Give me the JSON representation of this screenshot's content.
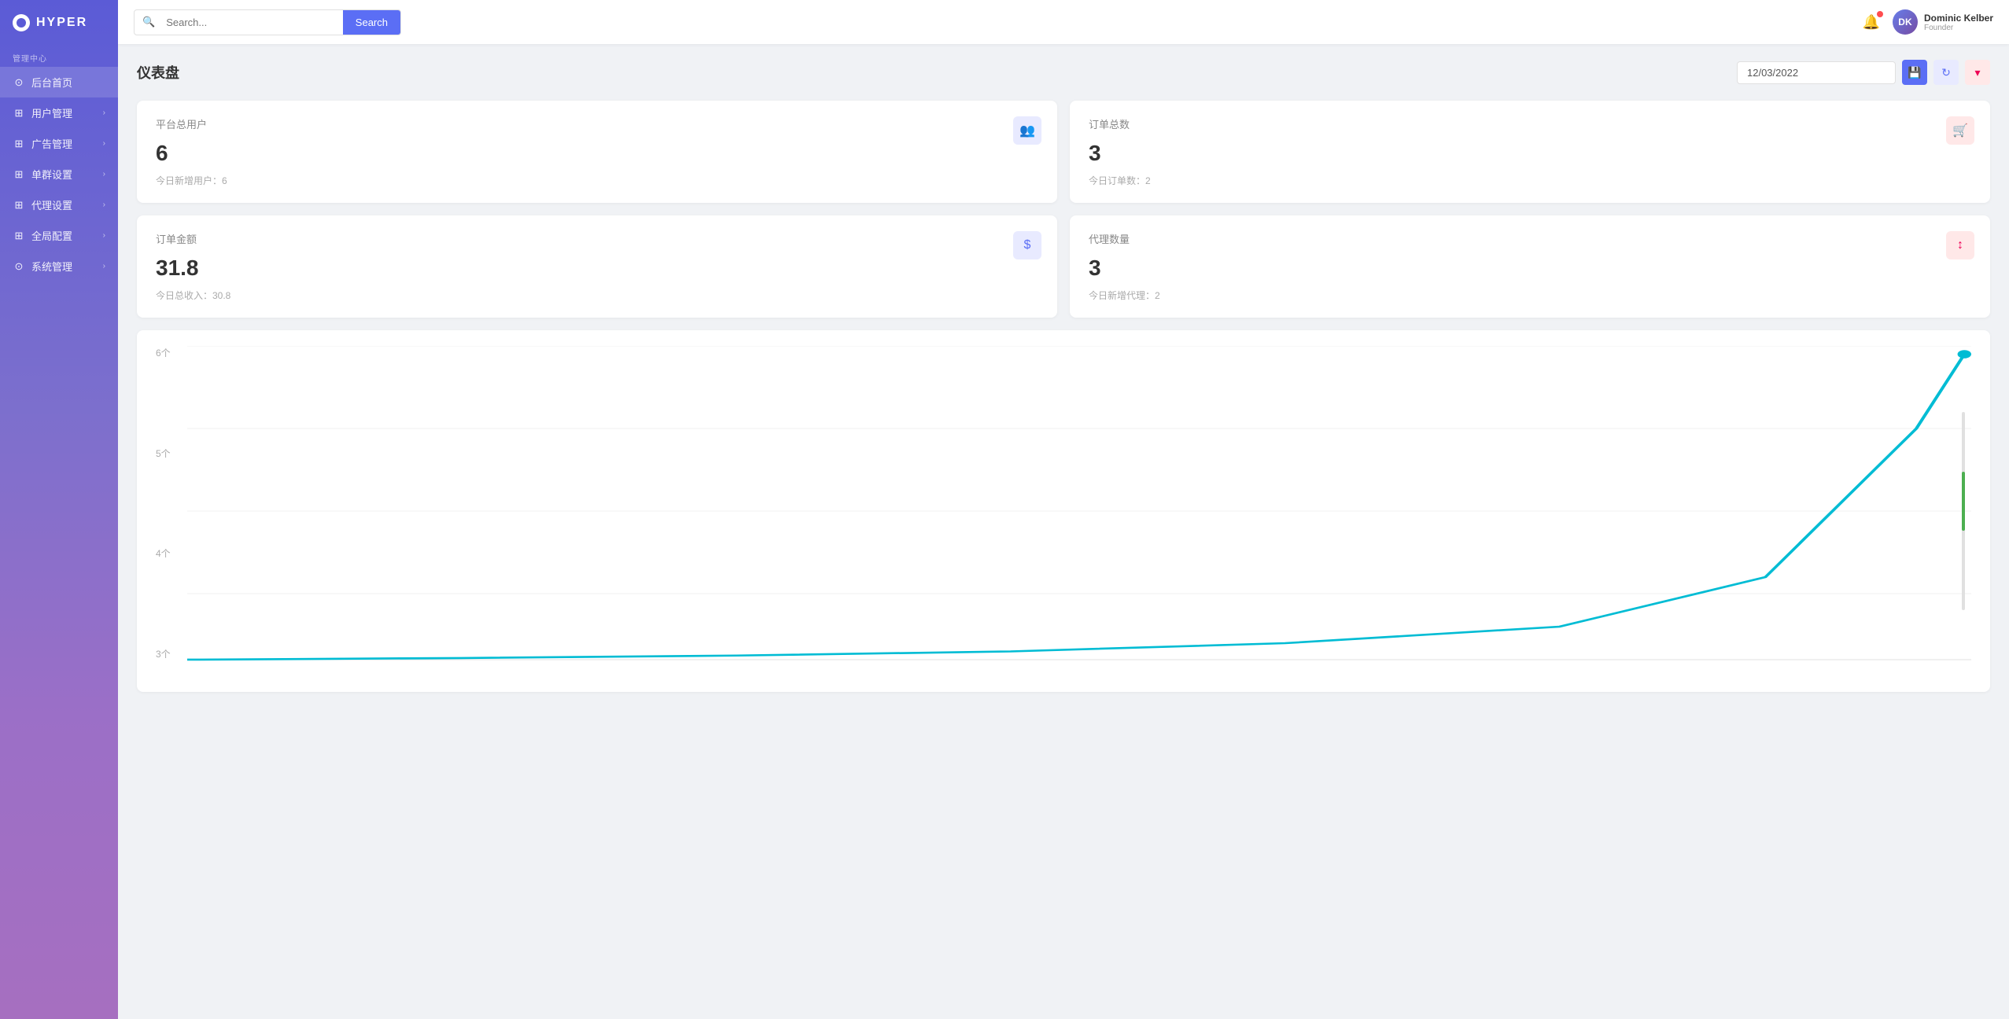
{
  "app": {
    "logo_text": "HYPER"
  },
  "sidebar": {
    "section_label": "管理中心",
    "items": [
      {
        "id": "home",
        "label": "后台首页",
        "icon": "⊙",
        "has_arrow": false,
        "active": true
      },
      {
        "id": "users",
        "label": "用户管理",
        "icon": "⊞",
        "has_arrow": true
      },
      {
        "id": "ads",
        "label": "广告管理",
        "icon": "⊞",
        "has_arrow": true
      },
      {
        "id": "groups",
        "label": "单群设置",
        "icon": "⊞",
        "has_arrow": true
      },
      {
        "id": "agents",
        "label": "代理设置",
        "icon": "⊞",
        "has_arrow": true
      },
      {
        "id": "global",
        "label": "全局配置",
        "icon": "⊞",
        "has_arrow": true
      },
      {
        "id": "system",
        "label": "系统管理",
        "icon": "⊙",
        "has_arrow": true
      }
    ]
  },
  "header": {
    "search_placeholder": "Search...",
    "search_button_label": "Search",
    "user_name": "Dominic Kelber",
    "user_role": "Founder"
  },
  "page": {
    "title": "仪表盘",
    "date": "12/03/2022"
  },
  "stats": [
    {
      "id": "total-users",
      "label": "平台总用户",
      "value": "6",
      "sub": "今日新增用户：6",
      "icon": "👥"
    },
    {
      "id": "total-orders",
      "label": "订单总数",
      "value": "3",
      "sub": "今日订单数：2",
      "icon": "🛒"
    },
    {
      "id": "order-amount",
      "label": "订单金额",
      "value": "31.8",
      "sub": "今日总收入：30.8",
      "icon": "$"
    },
    {
      "id": "agent-count",
      "label": "代理数量",
      "value": "3",
      "sub": "今日新增代理：2",
      "icon": "↕"
    }
  ],
  "chart": {
    "y_labels": [
      "6个",
      "5个",
      "4个",
      "3个"
    ]
  }
}
